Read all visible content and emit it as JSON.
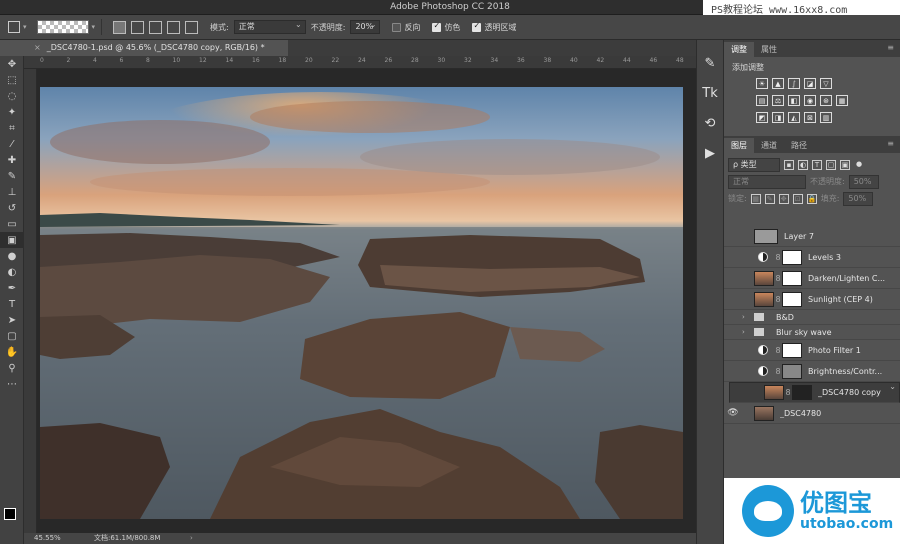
{
  "app": {
    "title": "Adobe Photoshop CC 2018"
  },
  "watermark": {
    "top_text": "PS教程论坛 www.16xx8.com",
    "bottom_cn": "优图宝",
    "bottom_en": "utobao.com"
  },
  "options": {
    "mode_label": "模式:",
    "mode_value": "正常",
    "opacity_label": "不透明度:",
    "opacity_value": "20%",
    "reverse_label": "反向",
    "dither_label": "仿色",
    "transparency_label": "透明区域",
    "reverse_checked": false,
    "dither_checked": true,
    "transparency_checked": true
  },
  "document": {
    "tab_title": "_DSC4780-1.psd @ 45.6% (_DSC4780 copy, RGB/16) *"
  },
  "ruler": {
    "ticks": [
      "0",
      "2",
      "4",
      "6",
      "8",
      "10",
      "12",
      "14",
      "16",
      "18",
      "20",
      "22",
      "24",
      "26",
      "28",
      "30",
      "32",
      "34",
      "36",
      "38",
      "40",
      "42",
      "44",
      "46",
      "48"
    ]
  },
  "status": {
    "zoom": "45.55%",
    "doc_size": "文档:61.1M/800.8M"
  },
  "panels": {
    "top_tabs": [
      "调整",
      "属性"
    ],
    "adjust_title": "添加调整",
    "layer_tabs": [
      "图层",
      "通道",
      "路径"
    ],
    "filter_label": "ρ 类型",
    "blend_mode": "正常",
    "opacity_label": "不透明度:",
    "opacity_value": "50%",
    "lock_label": "锁定:",
    "fill_label": "填充:",
    "fill_value": "50%"
  },
  "layers": [
    {
      "name": "Layer 7",
      "visible": false,
      "kind": "solid",
      "color": "#9a9a9a"
    },
    {
      "name": "Levels 3",
      "visible": false,
      "kind": "adjust",
      "mask": "#ffffff"
    },
    {
      "name": "Darken/Lighten C...",
      "visible": false,
      "kind": "photo-mask",
      "mask": "#ffffff"
    },
    {
      "name": "Sunlight (CEP 4)",
      "visible": false,
      "kind": "photo-mask",
      "mask": "#ffffff"
    },
    {
      "name": "B&D",
      "visible": false,
      "kind": "group"
    },
    {
      "name": "Blur sky wave",
      "visible": false,
      "kind": "group"
    },
    {
      "name": "Photo Filter 1",
      "visible": false,
      "kind": "adjust",
      "mask": "#ffffff"
    },
    {
      "name": "Brightness/Contr...",
      "visible": false,
      "kind": "adjust",
      "mask": "#888888"
    },
    {
      "name": "_DSC4780 copy",
      "visible": false,
      "kind": "photo-mask",
      "mask": "#222222",
      "selected": true
    },
    {
      "name": "_DSC4780",
      "visible": true,
      "kind": "photo"
    }
  ],
  "colors": {
    "panel_bg": "#535353",
    "dark_bg": "#282828",
    "accent": "#1c98d8"
  }
}
